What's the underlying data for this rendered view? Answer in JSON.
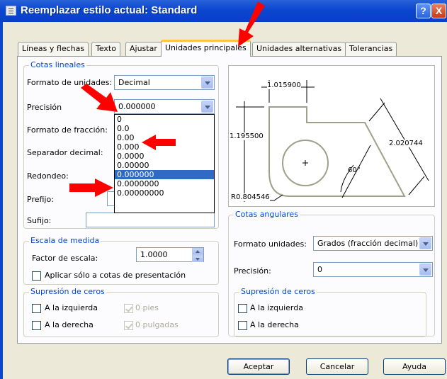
{
  "window": {
    "title": "Reemplazar estilo actual: Standard",
    "help_glyph": "?",
    "close_glyph": "X"
  },
  "tabs": [
    {
      "label": "Líneas y flechas"
    },
    {
      "label": "Texto"
    },
    {
      "label": "Ajustar"
    },
    {
      "label": "Unidades principales",
      "active": true
    },
    {
      "label": "Unidades alternativas"
    },
    {
      "label": "Tolerancias"
    }
  ],
  "linear": {
    "group_title": "Cotas lineales",
    "format_label": "Formato de unidades:",
    "format_value": "Decimal",
    "precision_label": "Precisión",
    "precision_value": "0.000000",
    "fraction_label": "Formato de fracción:",
    "separator_label": "Separador decimal:",
    "round_label": "Redondeo:",
    "prefix_label": "Prefijo:",
    "suffix_label": "Sufijo:"
  },
  "precision_dropdown": {
    "options": [
      "0",
      "0.0",
      "0.00",
      "0.000",
      "0.0000",
      "0.00000",
      "0.000000",
      "0.0000000",
      "0.00000000"
    ],
    "selected": "0.000000"
  },
  "scale": {
    "group_title": "Escala de medida",
    "factor_label": "Factor de escala:",
    "factor_value": "1.0000",
    "layout_only_label": "Aplicar sólo a cotas de presentación"
  },
  "zeros_linear": {
    "group_title": "Supresión de ceros",
    "leading_label": "A la izquierda",
    "trailing_label": "A la derecha",
    "feet_label": "0 pies",
    "inches_label": "0 pulgadas"
  },
  "preview": {
    "dim_top": "1.015900",
    "dim_left": "1.195500",
    "dim_right": "2.020744",
    "dim_angle": "60°",
    "dim_radius": "R0.804546"
  },
  "angular": {
    "group_title": "Cotas angulares",
    "format_label": "Formato unidades:",
    "format_value": "Grados (fracción decimal)",
    "precision_label": "Precisión:",
    "precision_value": "0"
  },
  "zeros_angular": {
    "group_title": "Supresión de ceros",
    "leading_label": "A la izquierda",
    "trailing_label": "A la derecha"
  },
  "buttons": {
    "ok": "Aceptar",
    "cancel": "Cancelar",
    "help": "Ayuda"
  },
  "colors": {
    "title_bar": "#0a46d0",
    "group_title": "#0046d5",
    "selection": "#316ac5",
    "annotation_arrows": "#ff0000"
  }
}
